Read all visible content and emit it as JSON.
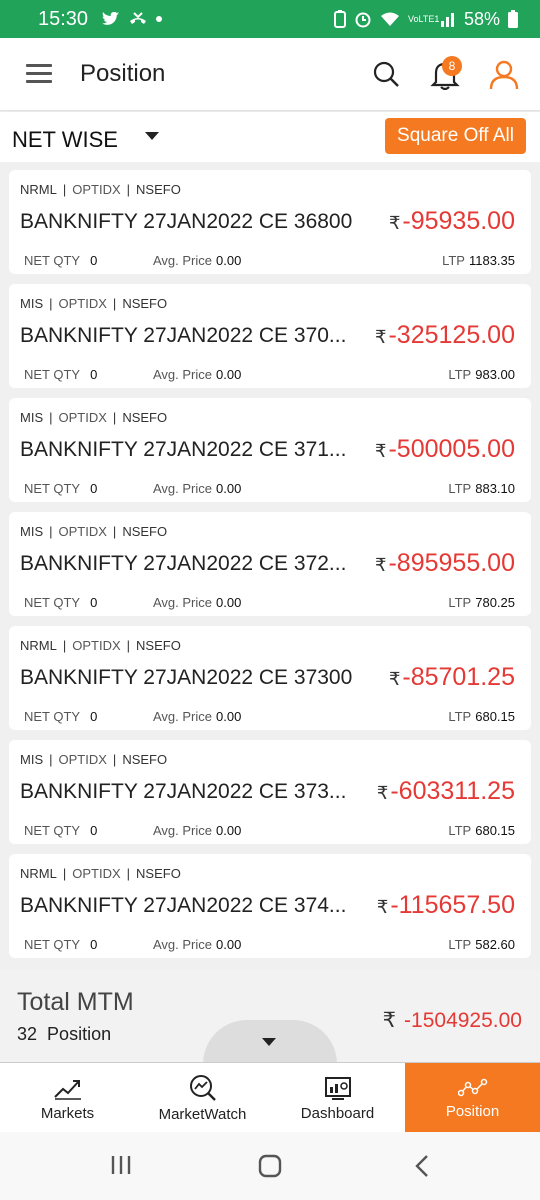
{
  "statusbar": {
    "time": "15:30",
    "battery": "58%",
    "net": "VoLTE1"
  },
  "header": {
    "title": "Position",
    "notifications": "8"
  },
  "filter": {
    "label": "NET WISE",
    "button": "Square Off All"
  },
  "positions": [
    {
      "product": "NRML",
      "segment": "OPTIDX",
      "exchange": "NSEFO",
      "symbol": "BANKNIFTY 27JAN2022 CE 36800",
      "pnl": "-95935.00",
      "net_qty_label": "NET QTY",
      "net_qty": "0",
      "avg_label": "Avg. Price",
      "avg": "0.00",
      "ltp_label": "LTP",
      "ltp": "1183.35"
    },
    {
      "product": "MIS",
      "segment": "OPTIDX",
      "exchange": "NSEFO",
      "symbol": "BANKNIFTY 27JAN2022 CE 370...",
      "pnl": "-325125.00",
      "net_qty_label": "NET QTY",
      "net_qty": "0",
      "avg_label": "Avg. Price",
      "avg": "0.00",
      "ltp_label": "LTP",
      "ltp": "983.00"
    },
    {
      "product": "MIS",
      "segment": "OPTIDX",
      "exchange": "NSEFO",
      "symbol": "BANKNIFTY 27JAN2022 CE 371...",
      "pnl": "-500005.00",
      "net_qty_label": "NET QTY",
      "net_qty": "0",
      "avg_label": "Avg. Price",
      "avg": "0.00",
      "ltp_label": "LTP",
      "ltp": "883.10"
    },
    {
      "product": "MIS",
      "segment": "OPTIDX",
      "exchange": "NSEFO",
      "symbol": "BANKNIFTY 27JAN2022 CE 372...",
      "pnl": "-895955.00",
      "net_qty_label": "NET QTY",
      "net_qty": "0",
      "avg_label": "Avg. Price",
      "avg": "0.00",
      "ltp_label": "LTP",
      "ltp": "780.25"
    },
    {
      "product": "NRML",
      "segment": "OPTIDX",
      "exchange": "NSEFO",
      "symbol": "BANKNIFTY 27JAN2022 CE 37300",
      "pnl": "-85701.25",
      "net_qty_label": "NET QTY",
      "net_qty": "0",
      "avg_label": "Avg. Price",
      "avg": "0.00",
      "ltp_label": "LTP",
      "ltp": "680.15"
    },
    {
      "product": "MIS",
      "segment": "OPTIDX",
      "exchange": "NSEFO",
      "symbol": "BANKNIFTY 27JAN2022 CE 373...",
      "pnl": "-603311.25",
      "net_qty_label": "NET QTY",
      "net_qty": "0",
      "avg_label": "Avg. Price",
      "avg": "0.00",
      "ltp_label": "LTP",
      "ltp": "680.15"
    },
    {
      "product": "NRML",
      "segment": "OPTIDX",
      "exchange": "NSEFO",
      "symbol": "BANKNIFTY 27JAN2022 CE 374...",
      "pnl": "-115657.50",
      "net_qty_label": "NET QTY",
      "net_qty": "0",
      "avg_label": "Avg. Price",
      "avg": "0.00",
      "ltp_label": "LTP",
      "ltp": "582.60"
    }
  ],
  "summary": {
    "label": "Total MTM",
    "count": "32",
    "count_label": "Position",
    "value": "-1504925.00"
  },
  "nav": [
    {
      "label": "Markets",
      "icon": "chart-line-icon"
    },
    {
      "label": "MarketWatch",
      "icon": "market-watch-icon"
    },
    {
      "label": "Dashboard",
      "icon": "dashboard-icon"
    },
    {
      "label": "Position",
      "icon": "position-icon",
      "active": true
    }
  ],
  "colors": {
    "accent": "#f47920",
    "status": "#21a35a",
    "loss": "#e53935"
  }
}
